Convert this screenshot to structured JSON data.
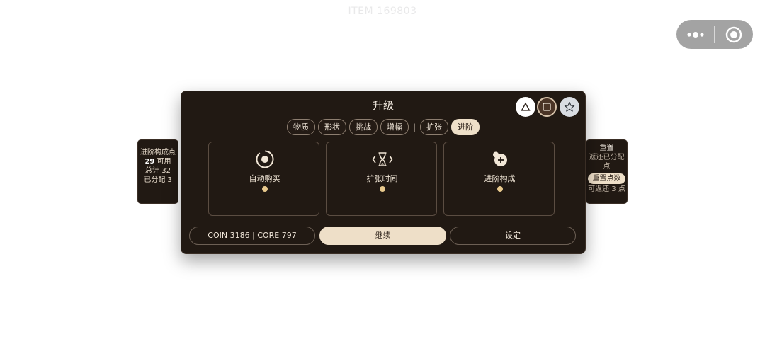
{
  "watermark": "ITEM 169803",
  "panel": {
    "title": "升级",
    "tabs": [
      {
        "label": "物质",
        "active": false
      },
      {
        "label": "形状",
        "active": false
      },
      {
        "label": "挑战",
        "active": false
      },
      {
        "label": "增幅",
        "active": false
      },
      {
        "label": "扩张",
        "active": false
      },
      {
        "label": "进阶",
        "active": true
      }
    ],
    "tab_separator": "|",
    "cards": [
      {
        "label": "自动购买",
        "icon": "target-circle-icon"
      },
      {
        "label": "扩张时间",
        "icon": "hourglass-icon"
      },
      {
        "label": "进阶构成",
        "icon": "plus-blob-icon"
      }
    ],
    "stats_label": "COIN 3186 | CORE 797",
    "continue_label": "继续",
    "settings_label": "设定"
  },
  "left_side": {
    "title": "进阶构成点",
    "available_value": "29",
    "available_label": "可用",
    "total_label": "总计",
    "total_value": "32",
    "assigned_label": "已分配",
    "assigned_value": "3"
  },
  "right_side": {
    "title": "重置",
    "subtitle": "返还已分配点",
    "button_label": "重置点数",
    "footer": "可返还 3 点"
  },
  "colors": {
    "panel_bg": "#211913",
    "accent_cream": "#eedfc8",
    "dot_gold": "#e8c98d"
  }
}
